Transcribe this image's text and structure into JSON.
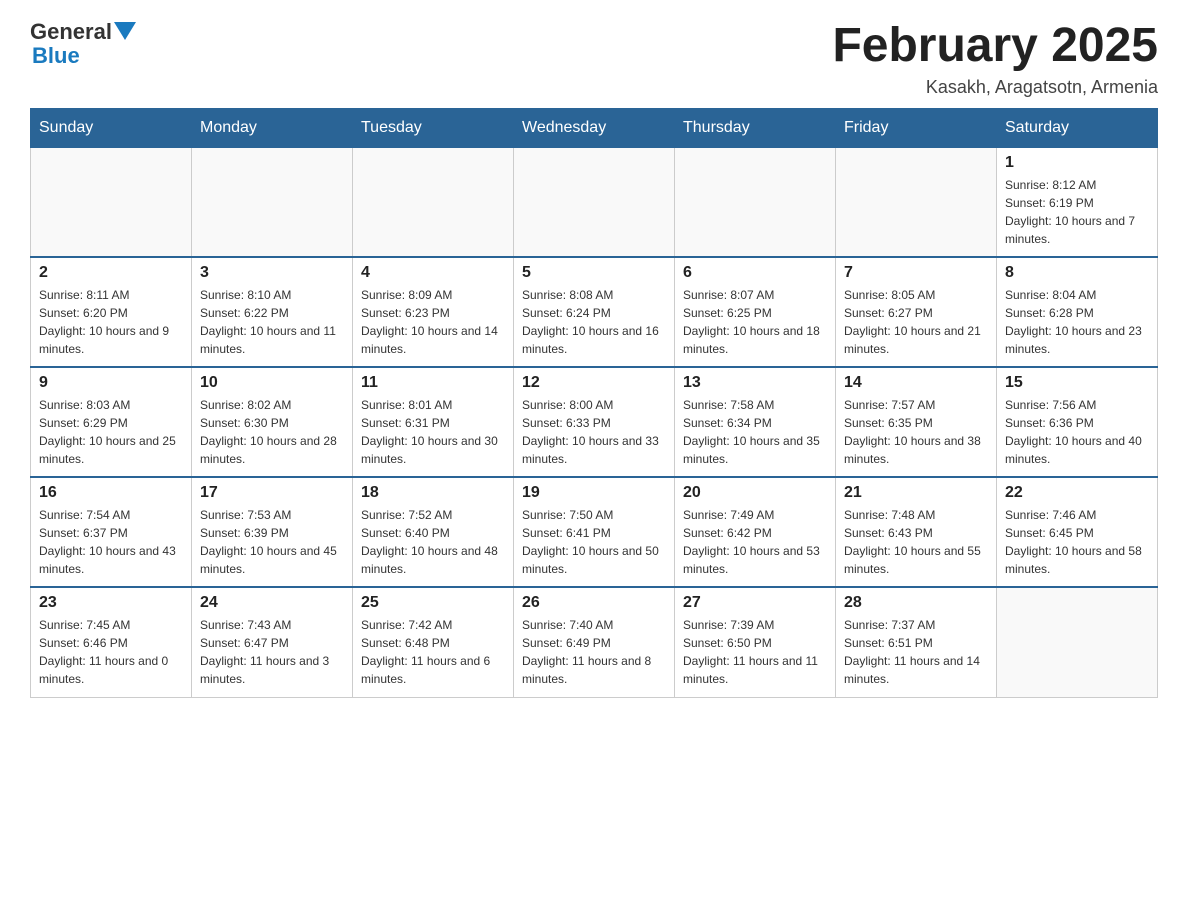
{
  "header": {
    "logo_general": "General",
    "logo_blue": "Blue",
    "month_title": "February 2025",
    "location": "Kasakh, Aragatsotn, Armenia"
  },
  "days_of_week": [
    "Sunday",
    "Monday",
    "Tuesday",
    "Wednesday",
    "Thursday",
    "Friday",
    "Saturday"
  ],
  "weeks": [
    [
      {
        "day": "",
        "info": ""
      },
      {
        "day": "",
        "info": ""
      },
      {
        "day": "",
        "info": ""
      },
      {
        "day": "",
        "info": ""
      },
      {
        "day": "",
        "info": ""
      },
      {
        "day": "",
        "info": ""
      },
      {
        "day": "1",
        "info": "Sunrise: 8:12 AM\nSunset: 6:19 PM\nDaylight: 10 hours and 7 minutes."
      }
    ],
    [
      {
        "day": "2",
        "info": "Sunrise: 8:11 AM\nSunset: 6:20 PM\nDaylight: 10 hours and 9 minutes."
      },
      {
        "day": "3",
        "info": "Sunrise: 8:10 AM\nSunset: 6:22 PM\nDaylight: 10 hours and 11 minutes."
      },
      {
        "day": "4",
        "info": "Sunrise: 8:09 AM\nSunset: 6:23 PM\nDaylight: 10 hours and 14 minutes."
      },
      {
        "day": "5",
        "info": "Sunrise: 8:08 AM\nSunset: 6:24 PM\nDaylight: 10 hours and 16 minutes."
      },
      {
        "day": "6",
        "info": "Sunrise: 8:07 AM\nSunset: 6:25 PM\nDaylight: 10 hours and 18 minutes."
      },
      {
        "day": "7",
        "info": "Sunrise: 8:05 AM\nSunset: 6:27 PM\nDaylight: 10 hours and 21 minutes."
      },
      {
        "day": "8",
        "info": "Sunrise: 8:04 AM\nSunset: 6:28 PM\nDaylight: 10 hours and 23 minutes."
      }
    ],
    [
      {
        "day": "9",
        "info": "Sunrise: 8:03 AM\nSunset: 6:29 PM\nDaylight: 10 hours and 25 minutes."
      },
      {
        "day": "10",
        "info": "Sunrise: 8:02 AM\nSunset: 6:30 PM\nDaylight: 10 hours and 28 minutes."
      },
      {
        "day": "11",
        "info": "Sunrise: 8:01 AM\nSunset: 6:31 PM\nDaylight: 10 hours and 30 minutes."
      },
      {
        "day": "12",
        "info": "Sunrise: 8:00 AM\nSunset: 6:33 PM\nDaylight: 10 hours and 33 minutes."
      },
      {
        "day": "13",
        "info": "Sunrise: 7:58 AM\nSunset: 6:34 PM\nDaylight: 10 hours and 35 minutes."
      },
      {
        "day": "14",
        "info": "Sunrise: 7:57 AM\nSunset: 6:35 PM\nDaylight: 10 hours and 38 minutes."
      },
      {
        "day": "15",
        "info": "Sunrise: 7:56 AM\nSunset: 6:36 PM\nDaylight: 10 hours and 40 minutes."
      }
    ],
    [
      {
        "day": "16",
        "info": "Sunrise: 7:54 AM\nSunset: 6:37 PM\nDaylight: 10 hours and 43 minutes."
      },
      {
        "day": "17",
        "info": "Sunrise: 7:53 AM\nSunset: 6:39 PM\nDaylight: 10 hours and 45 minutes."
      },
      {
        "day": "18",
        "info": "Sunrise: 7:52 AM\nSunset: 6:40 PM\nDaylight: 10 hours and 48 minutes."
      },
      {
        "day": "19",
        "info": "Sunrise: 7:50 AM\nSunset: 6:41 PM\nDaylight: 10 hours and 50 minutes."
      },
      {
        "day": "20",
        "info": "Sunrise: 7:49 AM\nSunset: 6:42 PM\nDaylight: 10 hours and 53 minutes."
      },
      {
        "day": "21",
        "info": "Sunrise: 7:48 AM\nSunset: 6:43 PM\nDaylight: 10 hours and 55 minutes."
      },
      {
        "day": "22",
        "info": "Sunrise: 7:46 AM\nSunset: 6:45 PM\nDaylight: 10 hours and 58 minutes."
      }
    ],
    [
      {
        "day": "23",
        "info": "Sunrise: 7:45 AM\nSunset: 6:46 PM\nDaylight: 11 hours and 0 minutes."
      },
      {
        "day": "24",
        "info": "Sunrise: 7:43 AM\nSunset: 6:47 PM\nDaylight: 11 hours and 3 minutes."
      },
      {
        "day": "25",
        "info": "Sunrise: 7:42 AM\nSunset: 6:48 PM\nDaylight: 11 hours and 6 minutes."
      },
      {
        "day": "26",
        "info": "Sunrise: 7:40 AM\nSunset: 6:49 PM\nDaylight: 11 hours and 8 minutes."
      },
      {
        "day": "27",
        "info": "Sunrise: 7:39 AM\nSunset: 6:50 PM\nDaylight: 11 hours and 11 minutes."
      },
      {
        "day": "28",
        "info": "Sunrise: 7:37 AM\nSunset: 6:51 PM\nDaylight: 11 hours and 14 minutes."
      },
      {
        "day": "",
        "info": ""
      }
    ]
  ]
}
